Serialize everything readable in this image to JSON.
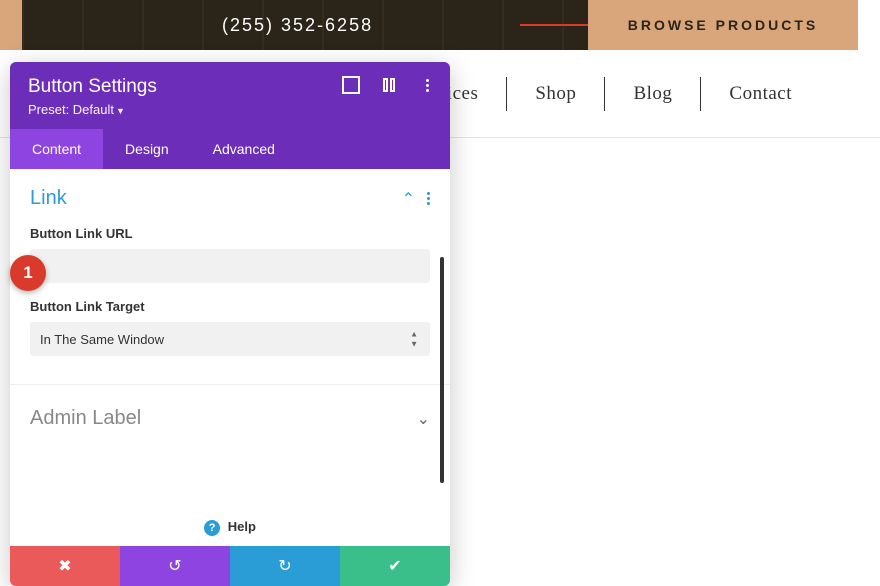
{
  "banner": {
    "phone": "(255) 352-6258",
    "browse_label": "BROWSE PRODUCTS"
  },
  "nav": {
    "items": [
      "Services",
      "Shop",
      "Blog",
      "Contact"
    ]
  },
  "panel": {
    "title": "Button Settings",
    "preset_label": "Preset: Default",
    "tabs": {
      "content": "Content",
      "design": "Design",
      "advanced": "Advanced"
    },
    "link": {
      "section_title": "Link",
      "url_label": "Button Link URL",
      "url_value": "",
      "target_label": "Button Link Target",
      "target_value": "In The Same Window"
    },
    "admin": {
      "section_title": "Admin Label"
    },
    "help_label": "Help"
  },
  "badge": {
    "num": "1"
  }
}
